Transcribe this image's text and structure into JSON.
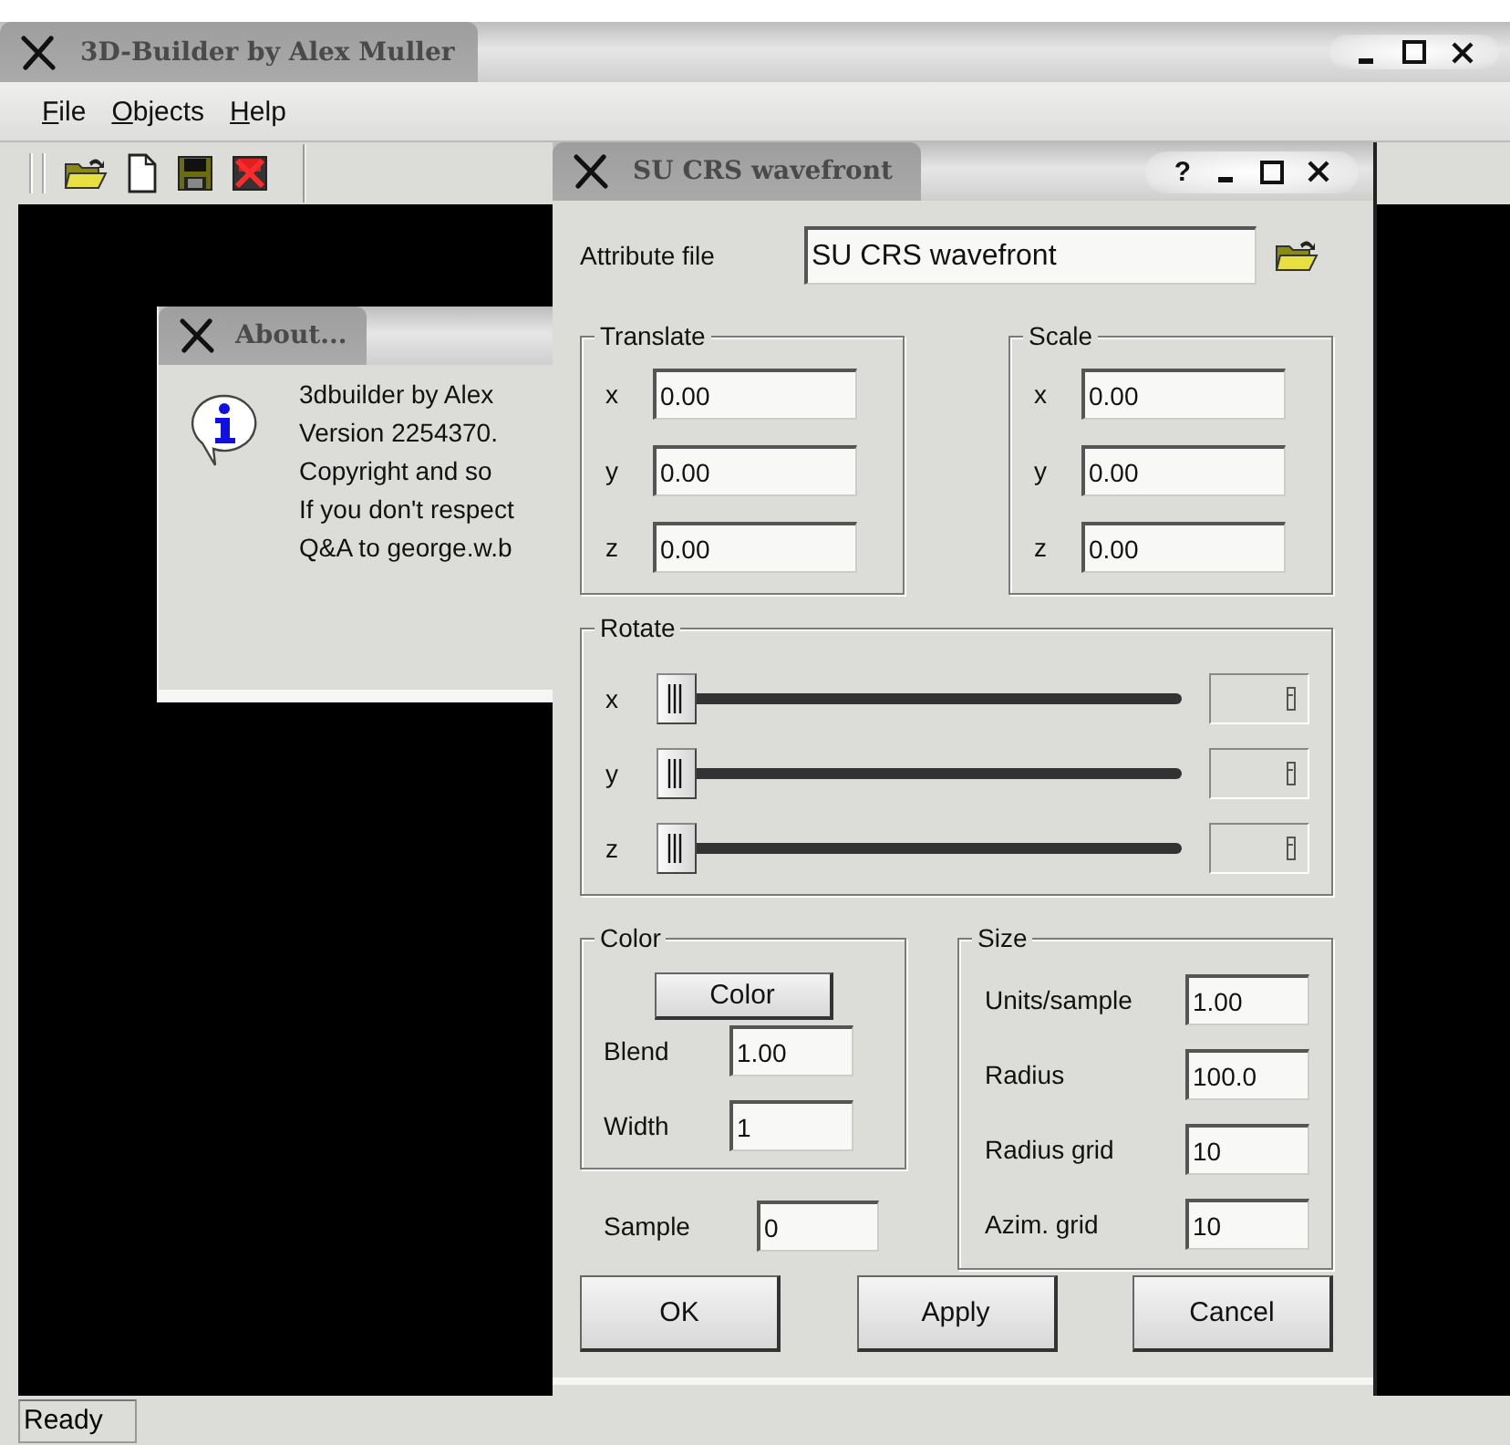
{
  "main_window": {
    "title": "3D-Builder by Alex Muller",
    "menu": [
      "File",
      "Objects",
      "Help"
    ],
    "status_bar": "Ready"
  },
  "about_dialog": {
    "title": "About...",
    "lines": [
      "3dbuilder by Alex",
      "Version 2254370.",
      "Copyright and so",
      "If you don't respect",
      "Q&A to george.w.b"
    ]
  },
  "attribute_dialog": {
    "title": "SU CRS wavefront",
    "help_button": "?",
    "attribute_file": {
      "label": "Attribute file",
      "value": "SU CRS wavefront"
    },
    "translate": {
      "title": "Translate",
      "fields": [
        {
          "label": "x",
          "value": "0.00"
        },
        {
          "label": "y",
          "value": "0.00"
        },
        {
          "label": "z",
          "value": "0.00"
        }
      ]
    },
    "scale": {
      "title": "Scale",
      "fields": [
        {
          "label": "x",
          "value": "0.00"
        },
        {
          "label": "y",
          "value": "0.00"
        },
        {
          "label": "z",
          "value": "0.00"
        }
      ]
    },
    "rotate": {
      "title": "Rotate",
      "sliders": [
        {
          "label": "x",
          "level": 0
        },
        {
          "label": "y",
          "level": 0
        },
        {
          "label": "z",
          "level": 0
        }
      ]
    },
    "color": {
      "title": "Color",
      "button": "Color",
      "fields": [
        {
          "label": "Blend",
          "value": "1.00"
        },
        {
          "label": "Width",
          "value": "1"
        }
      ]
    },
    "sample": {
      "label": "Sample",
      "value": "0"
    },
    "size": {
      "title": "Size",
      "fields": [
        {
          "label": "Units/sample",
          "value": "1.00"
        },
        {
          "label": "Radius",
          "value": "100.0"
        },
        {
          "label": "Radius grid",
          "value": "10"
        },
        {
          "label": "Azim. grid",
          "value": "10"
        }
      ]
    },
    "buttons": [
      "OK",
      "Apply",
      "Cancel"
    ]
  }
}
